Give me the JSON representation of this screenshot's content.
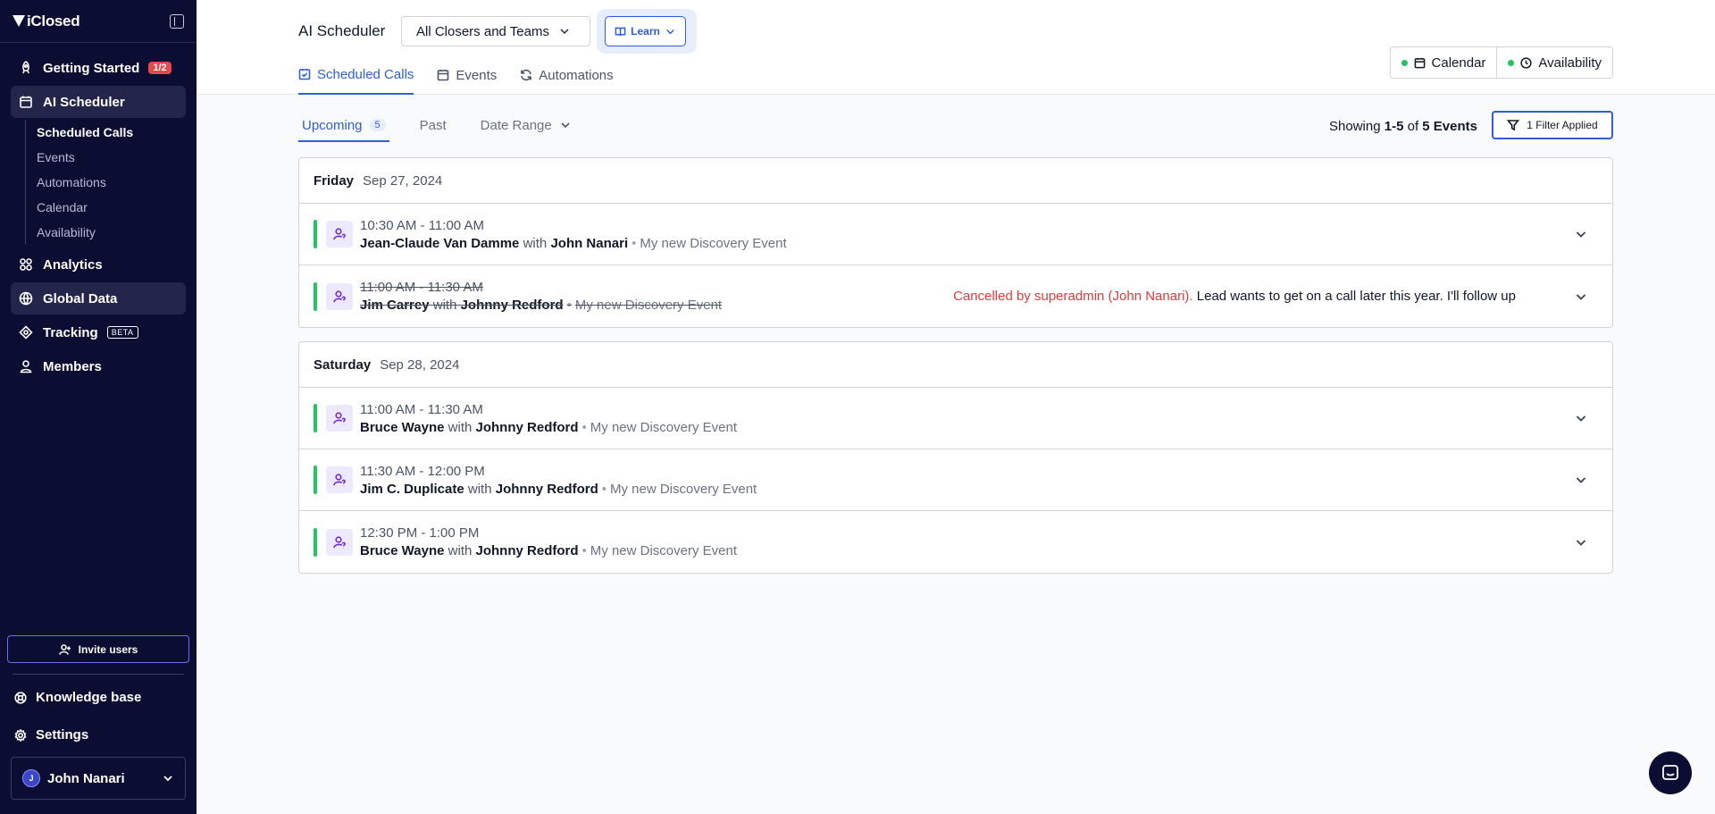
{
  "sidebar": {
    "logo": "iClosed",
    "nav": [
      {
        "label": "Getting Started",
        "badge": "1/2",
        "icon": "rocket-icon"
      },
      {
        "label": "AI Scheduler",
        "icon": "calendar-icon"
      }
    ],
    "subnav": [
      "Scheduled Calls",
      "Events",
      "Automations",
      "Calendar",
      "Availability"
    ],
    "nav2": [
      {
        "label": "Analytics",
        "icon": "grid-icon"
      },
      {
        "label": "Global Data",
        "icon": "globe-icon"
      },
      {
        "label": "Tracking",
        "badge": "BETA",
        "icon": "target-icon"
      },
      {
        "label": "Members",
        "icon": "users-icon"
      }
    ],
    "invite_label": "Invite users",
    "knowledge_label": "Knowledge base",
    "settings_label": "Settings",
    "user": {
      "name": "John Nanari",
      "initial": "J"
    }
  },
  "header": {
    "title": "AI Scheduler",
    "team_select": "All Closers and Teams",
    "learn_label": "Learn",
    "tabs": [
      "Scheduled Calls",
      "Events",
      "Automations"
    ],
    "toggles": [
      "Calendar",
      "Availability"
    ]
  },
  "filters": {
    "subtabs": {
      "upcoming": "Upcoming",
      "upcoming_count": "5",
      "past": "Past",
      "date_range": "Date Range"
    },
    "showing_prefix": "Showing ",
    "showing_range": "1-5",
    "showing_of": " of ",
    "showing_total": "5 Events",
    "filter_label": "1 Filter Applied"
  },
  "days": [
    {
      "dow": "Friday",
      "date": "Sep 27, 2024",
      "events": [
        {
          "time": "10:30 AM - 11:00 AM",
          "lead": "Jean-Claude Van Damme",
          "with": "with",
          "host": "John Nanari",
          "event": "My new Discovery Event"
        },
        {
          "time": "11:00 AM - 11:30 AM",
          "lead": "Jim Carrey",
          "with": "with",
          "host": "Johnny Redford",
          "event": "My new Discovery Event",
          "cancel_red": "Cancelled by superadmin (John Nanari).",
          "cancel_note": " Lead wants to get on a call later this year. I'll follow up"
        }
      ]
    },
    {
      "dow": "Saturday",
      "date": "Sep 28, 2024",
      "events": [
        {
          "time": "11:00 AM - 11:30 AM",
          "lead": "Bruce Wayne",
          "with": "with",
          "host": "Johnny Redford",
          "event": "My new Discovery Event"
        },
        {
          "time": "11:30 AM - 12:00 PM",
          "lead": "Jim C. Duplicate",
          "with": "with",
          "host": "Johnny Redford",
          "event": "My new Discovery Event"
        },
        {
          "time": "12:30 PM - 1:00 PM",
          "lead": "Bruce Wayne",
          "with": "with",
          "host": "Johnny Redford",
          "event": "My new Discovery Event"
        }
      ]
    }
  ],
  "colors": {
    "sidebar_bg": "#0c0d33",
    "accent": "#2f5fd6",
    "status_green": "#22c55e",
    "cancel_red": "#dc3c3c"
  }
}
